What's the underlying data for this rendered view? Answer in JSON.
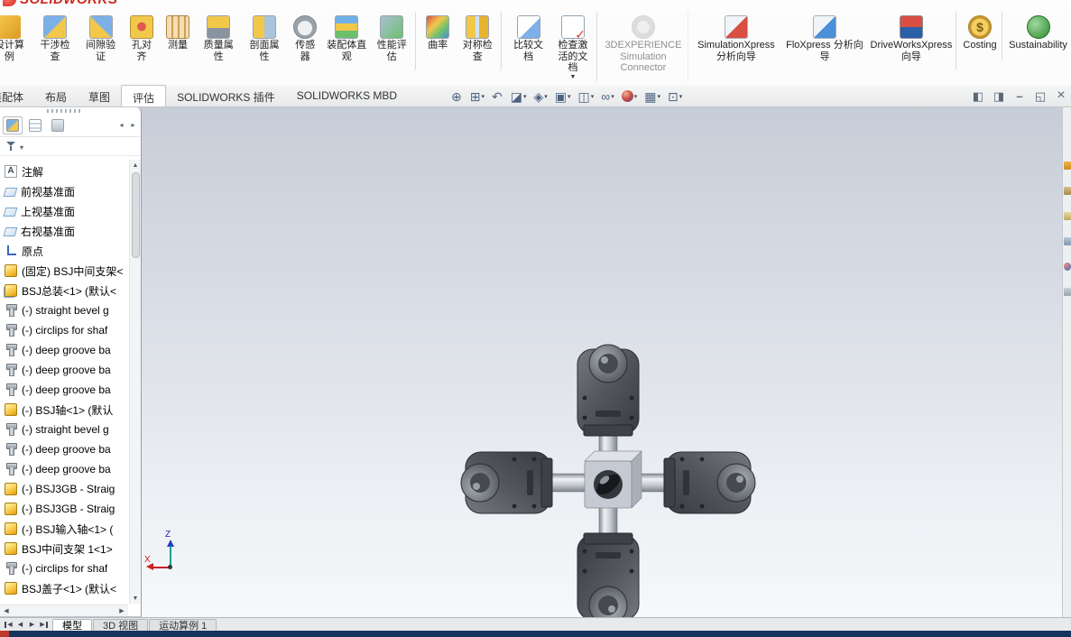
{
  "app": {
    "logo_text": "SOLIDWORKS"
  },
  "colors": {
    "brand_red": "#d1281e",
    "taskbar_blue": "#16355c",
    "viewport_top": "#c7cdd8",
    "viewport_bottom": "#f6f8fa"
  },
  "ribbon": {
    "buttons": [
      {
        "name": "ribbon-button-design-study",
        "icon": "design-study-icon",
        "label": "设计算例",
        "cls": "cut"
      },
      {
        "name": "ribbon-button-interference-check",
        "icon": "interference-check-icon",
        "label": "干涉检查"
      },
      {
        "name": "ribbon-button-clearance-verification",
        "icon": "clearance-verification-icon",
        "label": "间隙验证"
      },
      {
        "name": "ribbon-button-hole-alignment",
        "icon": "hole-alignment-icon",
        "label": "孔对齐"
      },
      {
        "name": "ribbon-button-measure",
        "icon": "measure-icon",
        "label": "测量"
      },
      {
        "name": "ribbon-button-mass-properties",
        "icon": "mass-properties-icon",
        "label": "质量属性"
      },
      {
        "name": "ribbon-button-section-properties",
        "icon": "section-properties-icon",
        "label": "剖面属性"
      },
      {
        "name": "ribbon-button-sensors",
        "icon": "sensor-icon",
        "label": "传感器"
      },
      {
        "name": "ribbon-button-assembly-visualization",
        "icon": "assembly-visualization-icon",
        "label": "装配体直观"
      },
      {
        "name": "ribbon-button-performance-evaluation",
        "icon": "performance-evaluation-icon",
        "label": "性能评估"
      },
      {
        "name": "ribbon-button-curvature",
        "icon": "curvature-icon",
        "label": "曲率"
      },
      {
        "name": "ribbon-button-symmetry-check",
        "icon": "symmetry-check-icon",
        "label": "对称检查"
      },
      {
        "name": "ribbon-button-compare-documents",
        "icon": "compare-documents-icon",
        "label": "比较文档"
      },
      {
        "name": "ribbon-button-check-active-document",
        "icon": "check-active-document-icon",
        "label": "检查激活的文档",
        "dd": "▼"
      },
      {
        "name": "ribbon-button-3dexperience-simulation-connector",
        "icon": "simulation-connector-icon",
        "label": "3DEXPERIENCE Simulation Connector",
        "cls": "wide disabled"
      },
      {
        "name": "ribbon-button-simulationxpress-wizard",
        "icon": "simulationxpress-icon",
        "label": "SimulationXpress 分析向导",
        "cls": "wide"
      },
      {
        "name": "ribbon-button-floxpress-wizard",
        "icon": "floxpress-icon",
        "label": "FloXpress 分析向导",
        "cls": "wide"
      },
      {
        "name": "ribbon-button-driveworksxpress-wizard",
        "icon": "driveworksxpress-icon",
        "label": "DriveWorksXpress 向导",
        "cls": "wide"
      },
      {
        "name": "ribbon-button-costing",
        "icon": "costing-icon",
        "label": "Costing",
        "cls": "wide"
      },
      {
        "name": "ribbon-button-sustainability",
        "icon": "sustainability-icon",
        "label": "Sustainability",
        "cls": "wide"
      }
    ]
  },
  "command_tabs": {
    "tabs": [
      {
        "name": "tab-assembly",
        "label": "装配体",
        "cls": "cut"
      },
      {
        "name": "tab-layout",
        "label": "布局"
      },
      {
        "name": "tab-sketch",
        "label": "草图"
      },
      {
        "name": "tab-evaluate",
        "label": "评估",
        "cls": "active"
      },
      {
        "name": "tab-solidworks-addins",
        "label": "SOLIDWORKS 插件"
      },
      {
        "name": "tab-solidworks-mbd",
        "label": "SOLIDWORKS MBD"
      }
    ]
  },
  "viewport_toolbar": {
    "tools": [
      {
        "name": "viewport-tool-zoom-fit",
        "icon": "zoom-fit-icon"
      },
      {
        "name": "viewport-tool-zoom-area",
        "icon": "zoom-area-icon",
        "dd": "▾"
      },
      {
        "name": "viewport-tool-previous-view",
        "icon": "previous-view-icon"
      },
      {
        "name": "viewport-tool-section-view",
        "icon": "section-view-icon",
        "dd": "▾"
      },
      {
        "name": "viewport-tool-dynamic-annotation-views",
        "icon": "dynamic-annotation-icon",
        "dd": "▾"
      },
      {
        "name": "viewport-tool-view-orientation",
        "icon": "view-orientation-icon",
        "dd": "▾"
      },
      {
        "name": "viewport-tool-display-style",
        "icon": "display-style-icon",
        "dd": "▾"
      },
      {
        "name": "viewport-tool-hide-show-items",
        "icon": "hide-show-items-icon",
        "dd": "▾"
      },
      {
        "name": "viewport-tool-edit-appearance",
        "icon": "edit-appearance-icon",
        "dd": "▾"
      },
      {
        "name": "viewport-tool-apply-scene",
        "icon": "apply-scene-icon",
        "dd": "▾"
      },
      {
        "name": "viewport-tool-view-settings",
        "icon": "view-settings-icon",
        "dd": "▾"
      }
    ]
  },
  "window_controls": {
    "buttons": [
      {
        "name": "left-pane-toggle-button",
        "icon": "left-pane-toggle-icon"
      },
      {
        "name": "right-pane-toggle-button",
        "icon": "right-pane-toggle-icon"
      },
      {
        "name": "minimize-button",
        "icon": "minimize-icon"
      },
      {
        "name": "restore-button",
        "icon": "restore-icon"
      },
      {
        "name": "close-button",
        "icon": "close-icon"
      }
    ]
  },
  "feature_panel": {
    "tabs": [
      {
        "name": "panel-tab-featuremanager",
        "icon": "featuremanager-tree-icon",
        "cls": "active"
      },
      {
        "name": "panel-tab-propertymanager",
        "icon": "propertymanager-icon"
      },
      {
        "name": "panel-tab-configurationmanager",
        "icon": "configurationmanager-icon"
      }
    ],
    "nav": [
      {
        "name": "panel-scroll-left-button",
        "icon": "panel-scroll-left-icon"
      },
      {
        "name": "panel-scroll-right-button",
        "icon": "panel-scroll-right-icon"
      }
    ],
    "filter": {
      "icon": "filter-funnel-icon",
      "dropdown_icon": "dropdown-arrow-icon"
    },
    "tree": {
      "items": [
        {
          "name": "tree-item-annotations",
          "icon": "annotation-icon",
          "label": "注解"
        },
        {
          "name": "tree-item-front-plane",
          "icon": "plane-icon",
          "label": "前视基准面"
        },
        {
          "name": "tree-item-top-plane",
          "icon": "plane-icon",
          "label": "上视基准面"
        },
        {
          "name": "tree-item-right-plane",
          "icon": "plane-icon",
          "label": "右视基准面"
        },
        {
          "name": "tree-item-origin",
          "icon": "origin-icon",
          "label": "原点"
        },
        {
          "name": "tree-item-bsj-center-bracket-fixed",
          "icon": "part-icon",
          "label": "(固定) BSJ中间支架<"
        },
        {
          "name": "tree-item-bsj-assembly",
          "icon": "assembly-icon",
          "label": "BSJ总装<1> (默认<"
        },
        {
          "name": "tree-item-straight-bevel-gear-1",
          "icon": "fastener-icon",
          "label": "(-) straight bevel g"
        },
        {
          "name": "tree-item-circlips-1",
          "icon": "fastener-icon",
          "label": "(-) circlips for shaf"
        },
        {
          "name": "tree-item-deep-groove-bearing-1",
          "icon": "fastener-icon",
          "label": "(-) deep groove ba"
        },
        {
          "name": "tree-item-deep-groove-bearing-2",
          "icon": "fastener-icon",
          "label": "(-) deep groove ba"
        },
        {
          "name": "tree-item-deep-groove-bearing-3",
          "icon": "fastener-icon",
          "label": "(-) deep groove ba"
        },
        {
          "name": "tree-item-bsj-shaft",
          "icon": "part-icon",
          "label": "(-) BSJ轴<1> (默认"
        },
        {
          "name": "tree-item-straight-bevel-gear-2",
          "icon": "fastener-icon",
          "label": "(-) straight bevel g"
        },
        {
          "name": "tree-item-deep-groove-bearing-4",
          "icon": "fastener-icon",
          "label": "(-) deep groove ba"
        },
        {
          "name": "tree-item-deep-groove-bearing-5",
          "icon": "fastener-icon",
          "label": "(-) deep groove ba"
        },
        {
          "name": "tree-item-bsj3gb-straight-1",
          "icon": "part-icon",
          "label": "(-) BSJ3GB - Straig"
        },
        {
          "name": "tree-item-bsj3gb-straight-2",
          "icon": "part-icon",
          "label": "(-) BSJ3GB - Straig"
        },
        {
          "name": "tree-item-bsj-input-shaft",
          "icon": "part-icon",
          "label": "(-) BSJ输入轴<1> ("
        },
        {
          "name": "tree-item-bsj-center-bracket-1",
          "icon": "part-icon",
          "label": "BSJ中间支架 1<1>"
        },
        {
          "name": "tree-item-circlips-2",
          "icon": "fastener-icon",
          "label": "(-) circlips for shaf"
        },
        {
          "name": "tree-item-bsj-cover",
          "icon": "part-icon",
          "label": "BSJ盖子<1> (默认<"
        }
      ]
    }
  },
  "viewport": {
    "triad": {
      "x_label": "X",
      "z_label": "Z"
    }
  },
  "task_pane": {
    "icons": [
      {
        "name": "taskpane-home",
        "icon": "taskpane-home-icon"
      },
      {
        "name": "taskpane-design-library",
        "icon": "taskpane-design-library-icon"
      },
      {
        "name": "taskpane-file-explorer",
        "icon": "taskpane-file-explorer-icon"
      },
      {
        "name": "taskpane-view-palette",
        "icon": "taskpane-view-palette-icon"
      },
      {
        "name": "taskpane-appearances",
        "icon": "taskpane-appearances-icon"
      },
      {
        "name": "taskpane-custom-properties",
        "icon": "taskpane-custom-properties-icon"
      }
    ]
  },
  "document_tabs": {
    "nav": [
      {
        "name": "doc-tab-scroll-first-button",
        "icon": "scroll-first-icon"
      },
      {
        "name": "doc-tab-scroll-prev-button",
        "icon": "scroll-prev-icon"
      },
      {
        "name": "doc-tab-scroll-next-button",
        "icon": "scroll-next-icon"
      },
      {
        "name": "doc-tab-scroll-last-button",
        "icon": "scroll-last-icon"
      }
    ],
    "tabs": [
      {
        "name": "tab-model",
        "label": "模型",
        "cls": "active"
      },
      {
        "name": "tab-3d-views",
        "label": "3D 视图"
      },
      {
        "name": "tab-motion-study-1",
        "label": "运动算例 1"
      }
    ]
  }
}
